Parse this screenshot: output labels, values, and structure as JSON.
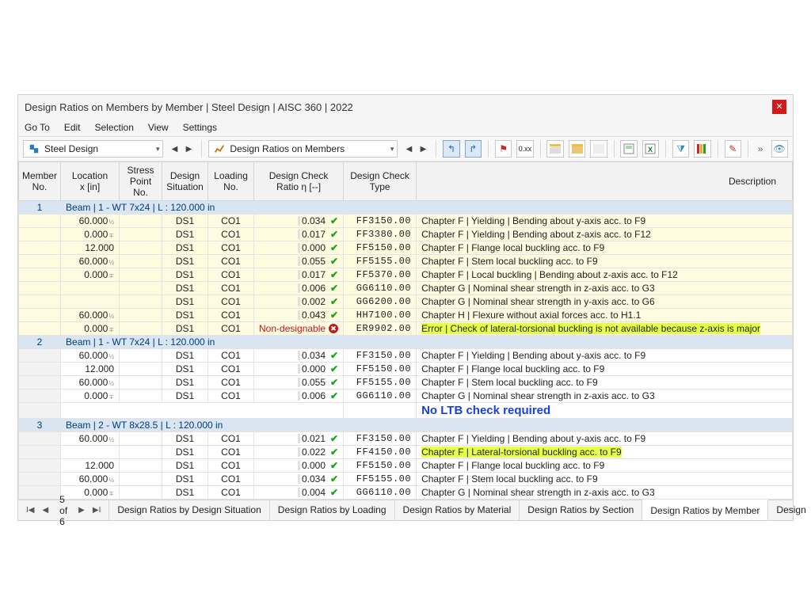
{
  "window": {
    "title": "Design Ratios on Members by Member | Steel Design | AISC 360 | 2022"
  },
  "menu": [
    "Go To",
    "Edit",
    "Selection",
    "View",
    "Settings"
  ],
  "toolbar": {
    "module": "Steel Design",
    "resultset": "Design Ratios on Members",
    "more": "»"
  },
  "columns": {
    "member": "Member\nNo.",
    "location": "Location\nx [in]",
    "stress": "Stress\nPoint No.",
    "situation": "Design\nSituation",
    "loading": "Loading\nNo.",
    "ratio": "Design Check\nRatio η [--]",
    "type": "Design Check\nType",
    "description": "Description"
  },
  "groups": [
    {
      "member": "1",
      "header": "Beam | 1 - WT 7x24 | L : 120.000 in",
      "rows": [
        {
          "loc": "60.000",
          "sub": "½",
          "ds": "DS1",
          "lo": "CO1",
          "ratio": "0.034",
          "ok": true,
          "type": "FF3150.00",
          "desc": "Chapter F | Yielding | Bending about y-axis acc. to F9",
          "yellow": true
        },
        {
          "loc": "0.000",
          "sub": "∓",
          "ds": "DS1",
          "lo": "CO1",
          "ratio": "0.017",
          "ok": true,
          "type": "FF3380.00",
          "desc": "Chapter F | Yielding | Bending about z-axis acc. to F12",
          "yellow": true
        },
        {
          "loc": "12.000",
          "sub": "",
          "ds": "DS1",
          "lo": "CO1",
          "ratio": "0.000",
          "ok": true,
          "type": "FF5150.00",
          "desc": "Chapter F | Flange local buckling acc. to F9",
          "yellow": true
        },
        {
          "loc": "60.000",
          "sub": "½",
          "ds": "DS1",
          "lo": "CO1",
          "ratio": "0.055",
          "ok": true,
          "type": "FF5155.00",
          "desc": "Chapter F | Stem local buckling acc. to F9",
          "yellow": true
        },
        {
          "loc": "0.000",
          "sub": "∓",
          "ds": "DS1",
          "lo": "CO1",
          "ratio": "0.017",
          "ok": true,
          "type": "FF5370.00",
          "desc": "Chapter F | Local buckling | Bending about z-axis acc. to F12",
          "yellow": true
        },
        {
          "loc": "",
          "sub": "",
          "ds": "DS1",
          "lo": "CO1",
          "ratio": "0.006",
          "ok": true,
          "type": "GG6110.00",
          "desc": "Chapter G | Nominal shear strength in z-axis acc. to G3",
          "yellow": true
        },
        {
          "loc": "",
          "sub": "",
          "ds": "DS1",
          "lo": "CO1",
          "ratio": "0.002",
          "ok": true,
          "type": "GG6200.00",
          "desc": "Chapter G | Nominal shear strength in y-axis acc. to G6",
          "yellow": true
        },
        {
          "loc": "60.000",
          "sub": "½",
          "ds": "DS1",
          "lo": "CO1",
          "ratio": "0.043",
          "ok": true,
          "type": "HH7100.00",
          "desc": "Chapter H | Flexure without axial forces acc. to H1.1",
          "yellow": true
        },
        {
          "loc": "0.000",
          "sub": "∓",
          "ds": "DS1",
          "lo": "CO1",
          "ratio": "",
          "nondesign": "Non-designable",
          "type": "ER9902.00",
          "desc": "Error | Check of lateral-torsional buckling is not available because z-axis is major",
          "yellow": true,
          "hl": "error"
        }
      ],
      "callout": ""
    },
    {
      "member": "2",
      "header": "Beam | 1 - WT 7x24 | L : 120.000 in",
      "rows": [
        {
          "loc": "60.000",
          "sub": "½",
          "ds": "DS1",
          "lo": "CO1",
          "ratio": "0.034",
          "ok": true,
          "type": "FF3150.00",
          "desc": "Chapter F | Yielding | Bending about y-axis acc. to F9"
        },
        {
          "loc": "12.000",
          "sub": "",
          "ds": "DS1",
          "lo": "CO1",
          "ratio": "0.000",
          "ok": true,
          "type": "FF5150.00",
          "desc": "Chapter F | Flange local buckling acc. to F9"
        },
        {
          "loc": "60.000",
          "sub": "½",
          "ds": "DS1",
          "lo": "CO1",
          "ratio": "0.055",
          "ok": true,
          "type": "FF5155.00",
          "desc": "Chapter F | Stem local buckling acc. to F9"
        },
        {
          "loc": "0.000",
          "sub": "∓",
          "ds": "DS1",
          "lo": "CO1",
          "ratio": "0.006",
          "ok": true,
          "type": "GG6110.00",
          "desc": "Chapter G | Nominal shear strength in z-axis acc. to G3"
        }
      ],
      "callout": "No LTB check required"
    },
    {
      "member": "3",
      "header": "Beam | 2 - WT 8x28.5 | L : 120.000 in",
      "rows": [
        {
          "loc": "60.000",
          "sub": "½",
          "ds": "DS1",
          "lo": "CO1",
          "ratio": "0.021",
          "ok": true,
          "type": "FF3150.00",
          "desc": "Chapter F | Yielding | Bending about y-axis acc. to F9"
        },
        {
          "loc": "",
          "sub": "",
          "ds": "DS1",
          "lo": "CO1",
          "ratio": "0.022",
          "ok": true,
          "type": "FF4150.00",
          "desc": "Chapter F | Lateral-torsional buckling acc. to F9",
          "hl": "ltb"
        },
        {
          "loc": "12.000",
          "sub": "",
          "ds": "DS1",
          "lo": "CO1",
          "ratio": "0.000",
          "ok": true,
          "type": "FF5150.00",
          "desc": "Chapter F | Flange local buckling acc. to F9"
        },
        {
          "loc": "60.000",
          "sub": "½",
          "ds": "DS1",
          "lo": "CO1",
          "ratio": "0.034",
          "ok": true,
          "type": "FF5155.00",
          "desc": "Chapter F | Stem local buckling acc. to F9"
        },
        {
          "loc": "0.000",
          "sub": "∓",
          "ds": "DS1",
          "lo": "CO1",
          "ratio": "0.004",
          "ok": true,
          "type": "GG6110.00",
          "desc": "Chapter G | Nominal shear strength in z-axis acc. to G3"
        }
      ],
      "callout": ""
    }
  ],
  "footer": {
    "page": "5 of 6",
    "tabs": [
      "Design Ratios by Design Situation",
      "Design Ratios by Loading",
      "Design Ratios by Material",
      "Design Ratios by Section",
      "Design Ratios by Member",
      "Design"
    ],
    "active": 4
  }
}
